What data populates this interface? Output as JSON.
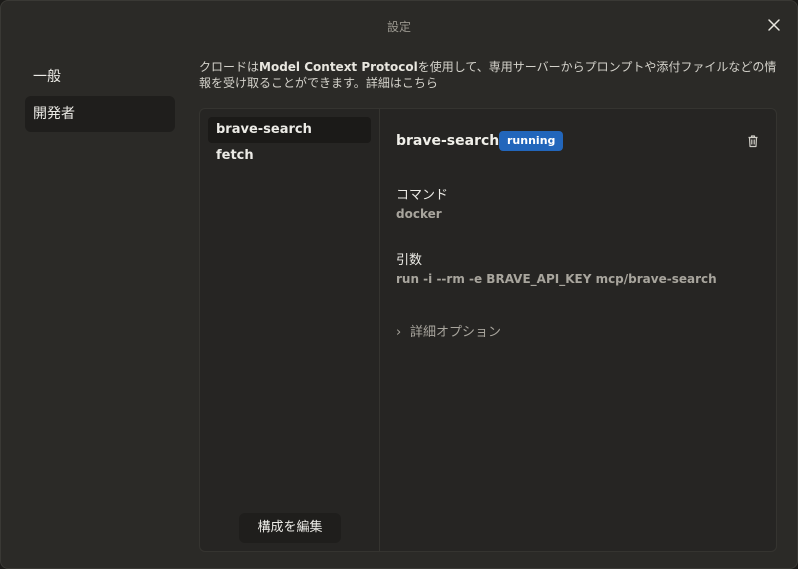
{
  "window": {
    "title": "設定"
  },
  "nav": {
    "items": [
      {
        "label": "一般",
        "active": false
      },
      {
        "label": "開発者",
        "active": true
      }
    ]
  },
  "description": {
    "prefix": "クロードは",
    "bold": "Model Context Protocol",
    "middle": "を使用して、専用サーバーからプロンプトや添付ファイルなどの情報を受け取ることができます。",
    "link": "詳細はこちら"
  },
  "servers": {
    "items": [
      {
        "label": "brave-search",
        "active": true
      },
      {
        "label": "fetch",
        "active": false
      }
    ],
    "edit_button": "構成を編集"
  },
  "detail": {
    "name": "brave-search",
    "status": "running",
    "command_label": "コマンド",
    "command_value": "docker",
    "args_label": "引数",
    "args_value": "run -i --rm -e BRAVE_API_KEY mcp/brave-search",
    "advanced_label": "詳細オプション"
  },
  "icons": {
    "close": "close-icon",
    "trash": "trash-icon",
    "chevron": "chevron-right-icon"
  },
  "colors": {
    "background": "#2b2a27",
    "panel": "#262523",
    "badge": "#2266bb",
    "active_item": "#1b1a18"
  }
}
